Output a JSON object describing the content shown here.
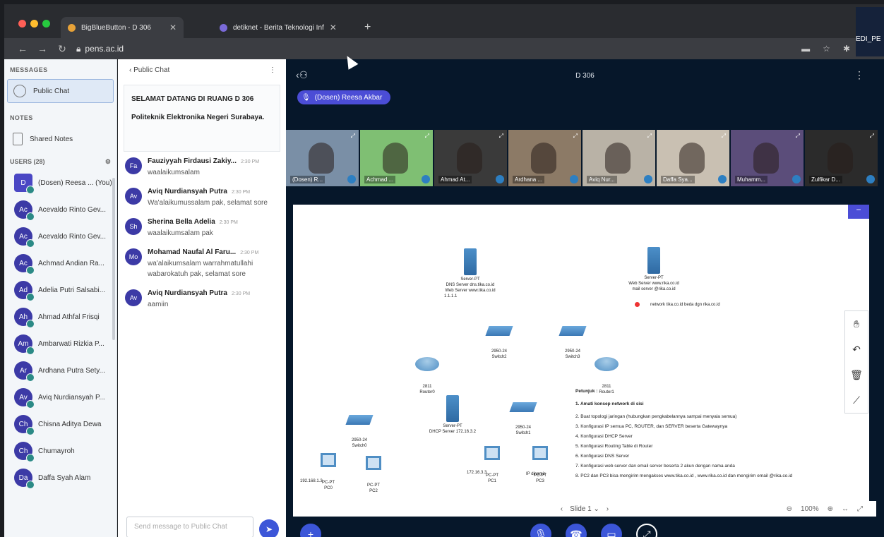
{
  "browser": {
    "tabs": [
      {
        "title": "BigBlueButton - D 306"
      },
      {
        "title": "detiknet - Berita Teknologi Inf"
      }
    ],
    "url": "pens.ac.id",
    "profile_label": "EDI_PE"
  },
  "leftnav": {
    "messages_title": "MESSAGES",
    "public_chat": "Public Chat",
    "notes_title": "NOTES",
    "shared_notes": "Shared Notes",
    "users_title": "USERS (28)",
    "users": [
      {
        "initials": "D",
        "name": "(Dosen) Reesa ... (You)"
      },
      {
        "initials": "Ac",
        "name": "Acevaldo Rinto Gev..."
      },
      {
        "initials": "Ac",
        "name": "Acevaldo Rinto Gev..."
      },
      {
        "initials": "Ac",
        "name": "Achmad Andian Ra..."
      },
      {
        "initials": "Ad",
        "name": "Adelia Putri Salsabi..."
      },
      {
        "initials": "Ah",
        "name": "Ahmad Athfal Frisqi"
      },
      {
        "initials": "Am",
        "name": "Ambarwati Rizkia P..."
      },
      {
        "initials": "Ar",
        "name": "Ardhana Putra Sety..."
      },
      {
        "initials": "Av",
        "name": "Aviq Nurdiansyah P..."
      },
      {
        "initials": "Ch",
        "name": "Chisna Aditya Dewa"
      },
      {
        "initials": "Ch",
        "name": "Chumayroh"
      },
      {
        "initials": "Da",
        "name": "Daffa Syah Alam"
      }
    ]
  },
  "chat": {
    "header": "Public Chat",
    "welcome_line1": "SELAMAT DATANG DI RUANG D 306",
    "welcome_line2": "Politeknik Elektronika Negeri Surabaya.",
    "messages": [
      {
        "initials": "Fa",
        "name": "Fauziyyah Firdausi Zakiy...",
        "time": "2:30 PM",
        "text": "waalaikumsalam"
      },
      {
        "initials": "Av",
        "name": "Aviq Nurdiansyah Putra",
        "time": "2:30 PM",
        "text": "Wa'alaikumussalam pak, selamat sore"
      },
      {
        "initials": "Sh",
        "name": "Sherina Bella Adelia",
        "time": "2:30 PM",
        "text": "waalaikumsalam pak"
      },
      {
        "initials": "Mo",
        "name": "Mohamad Naufal Al Faru...",
        "time": "2:30 PM",
        "text": "wa'alaikumsalam warrahmatullahi wabarokatuh pak, selamat sore"
      },
      {
        "initials": "Av",
        "name": "Aviq Nurdiansyah Putra",
        "time": "2:30 PM",
        "text": "aamiin"
      }
    ],
    "input_placeholder": "Send message to Public Chat"
  },
  "main": {
    "title": "D 306",
    "presenter": "(Dosen) Reesa Akbar",
    "videos": [
      {
        "name": "(Dosen) R...",
        "bg": "#7a8fa6"
      },
      {
        "name": "Achmad ...",
        "bg": "#7fbf73"
      },
      {
        "name": "Ahmad At...",
        "bg": "#3a3a3a"
      },
      {
        "name": "Ardhana ...",
        "bg": "#8c7a66"
      },
      {
        "name": "Aviq Nur...",
        "bg": "#b9b2a6"
      },
      {
        "name": "Daffa Sya...",
        "bg": "#c9c0b2"
      },
      {
        "name": "Muhamm...",
        "bg": "#5b4d7a"
      },
      {
        "name": "Zulfikar D...",
        "bg": "#2b2b2b"
      }
    ],
    "slide_label": "Slide 1",
    "zoom": "100%"
  },
  "diagram": {
    "dns_server": "Server-PT",
    "dns_line1": "DNS Server dns.tika.co.id",
    "dns_line2": "Web Server www.tika.co.id",
    "dns_ip": "1.1.1.1",
    "web_server": "Server-PT",
    "web_line1": "Web Server www.rika.co.id",
    "web_line2": "mail server @rika.co.id",
    "network_note": "network tika.co.id beda dgn rika.co.id",
    "switch2": "2950-24\nSwitch2",
    "switch3": "2950-24\nSwitch3",
    "router0": "2811\nRouter0",
    "router1": "2811\nRouter1",
    "switch0": "2950-24\nSwitch0",
    "dhcp_server": "Server-PT",
    "dhcp_line": "DHCP Server 172.16.3.2",
    "switch1": "2950-24\nSwitch1",
    "pc0": "PC-PT\nPC0",
    "pc2": "PC-PT\nPC2",
    "pc1": "PC-PT\nPC1",
    "pc1_ip": "172.16.3.3",
    "pc3": "PC-PT\nPC3",
    "pc3_ip": "IP dinamis",
    "pc0_ip": "192.168.1.3",
    "notes_title": "Petunjuk :",
    "notes": [
      "1. Amati konsep network di sisi",
      "2. Buat topologi jaringan (hubungkan pengkabelannya sampai menyala semua)",
      "3. Konfigurasi IP semua PC, ROUTER, dan SERVER beserta Gatewaynya",
      "4. Konfigurasi DHCP Server",
      "5. Konfigurasi Routing Table di Router",
      "6. Konfigurasi DNS Server",
      "7. Konfigurasi web server dan email server beserta 2 akun dengan nama anda",
      "8. PC2 dan PC3 bisa mengirim mengakses www.tika.co.id , www.rika.co.id dan mengirim email @rika.co.id"
    ]
  },
  "colors": {
    "accent": "#4b4dd6",
    "avatar": "#3c3aa6",
    "bg_main": "#06172a"
  }
}
